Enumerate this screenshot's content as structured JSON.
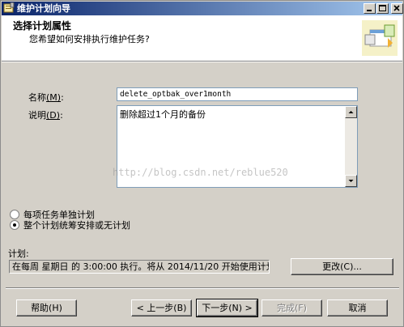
{
  "window": {
    "title": "维护计划向导"
  },
  "header": {
    "title": "选择计划属性",
    "subtitle": "您希望如何安排执行维护任务?"
  },
  "form": {
    "name_label": "名称",
    "name_hotkey": "(M)",
    "name_colon": ":",
    "name_value": "delete_optbak_over1month",
    "desc_label": "说明",
    "desc_hotkey": "(D)",
    "desc_colon": ":",
    "desc_value": "删除超过1个月的备份"
  },
  "watermark": "http://blog.csdn.net/reblue520",
  "options": {
    "separate": "每项任务单独计划",
    "single": "整个计划统筹安排或无计划",
    "selected": "single"
  },
  "schedule": {
    "label": "计划:",
    "value": "在每周 星期日 的 3:00:00 执行。将从 2014/11/20 开始使用计划。",
    "change_button": "更改(C)..."
  },
  "footer": {
    "help": "帮助(H)",
    "back": "< 上一步(B)",
    "next": "下一步(N) >",
    "finish": "完成(F)",
    "cancel": "取消"
  },
  "icons": [
    "app-icon",
    "minimize-icon",
    "maximize-icon",
    "close-icon",
    "wizard-graphic-icon",
    "scroll-up-icon",
    "scroll-down-icon"
  ]
}
